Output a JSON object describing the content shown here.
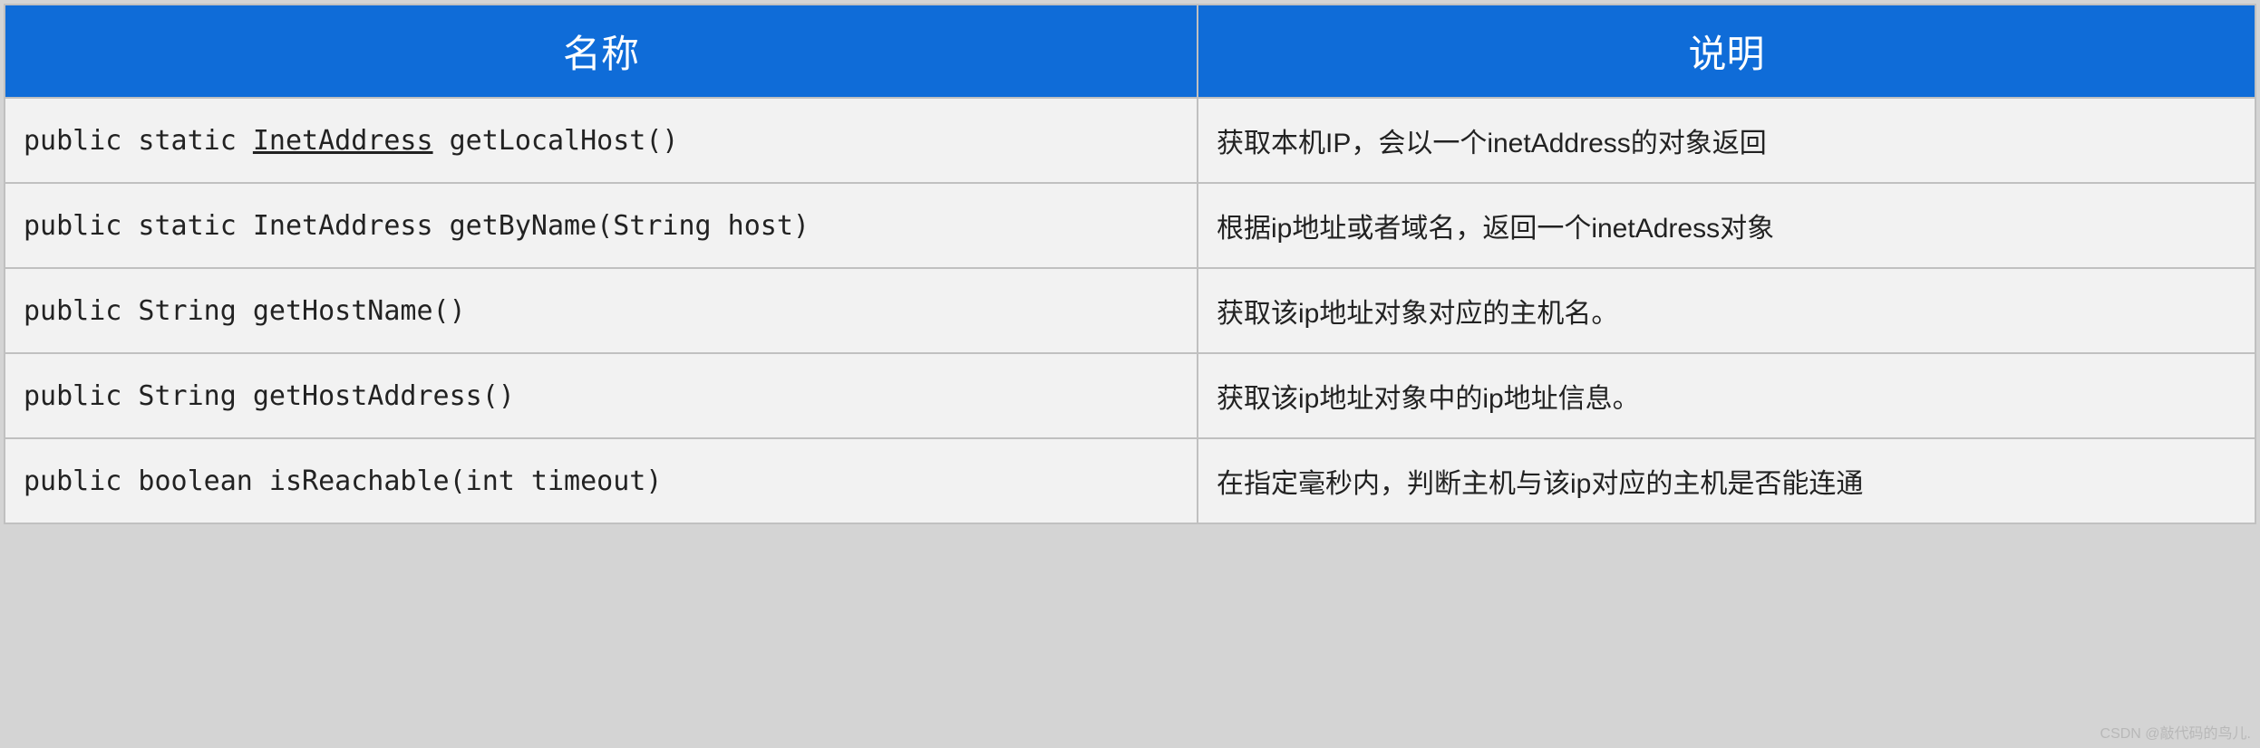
{
  "headers": {
    "name": "名称",
    "desc": "说明"
  },
  "rows": [
    {
      "name_prefix": "public static ",
      "name_underlined": "InetAddress",
      "name_suffix": " getLocalHost()",
      "desc": "获取本机IP，会以一个inetAddress的对象返回"
    },
    {
      "name_prefix": "public static InetAddress getByName(String host)",
      "name_underlined": "",
      "name_suffix": "",
      "desc": "根据ip地址或者域名，返回一个inetAdress对象"
    },
    {
      "name_prefix": "public String getHostName()",
      "name_underlined": "",
      "name_suffix": "",
      "desc": "获取该ip地址对象对应的主机名。"
    },
    {
      "name_prefix": "public String getHostAddress()",
      "name_underlined": "",
      "name_suffix": "",
      "desc": "获取该ip地址对象中的ip地址信息。"
    },
    {
      "name_prefix": "public boolean isReachable(int timeout)",
      "name_underlined": "",
      "name_suffix": "",
      "desc": "在指定毫秒内，判断主机与该ip对应的主机是否能连通"
    }
  ],
  "watermark": "CSDN @敲代码的鸟儿."
}
